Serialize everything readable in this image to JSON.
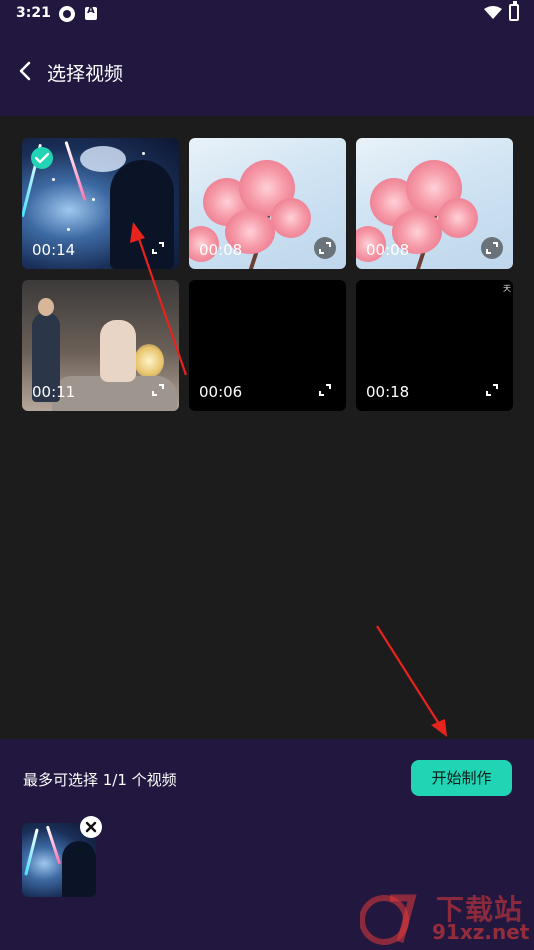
{
  "status_bar": {
    "time": "3:21"
  },
  "header": {
    "title": "选择视频"
  },
  "videos": [
    {
      "duration": "00:14",
      "selected": true
    },
    {
      "duration": "00:08",
      "selected": false
    },
    {
      "duration": "00:08",
      "selected": false
    },
    {
      "duration": "00:11",
      "selected": false
    },
    {
      "duration": "00:06",
      "selected": false
    },
    {
      "duration": "00:18",
      "selected": false,
      "badge": "天"
    }
  ],
  "bottom": {
    "hint": "最多可选择 1/1 个视频",
    "start_button": "开始制作"
  },
  "watermark": {
    "brand": "下载站",
    "url": "91xz.net"
  },
  "colors": {
    "accent": "#21d4b4",
    "header_bg": "#22173f",
    "content_bg": "#1c1c1c",
    "annotation": "#e8231e"
  }
}
